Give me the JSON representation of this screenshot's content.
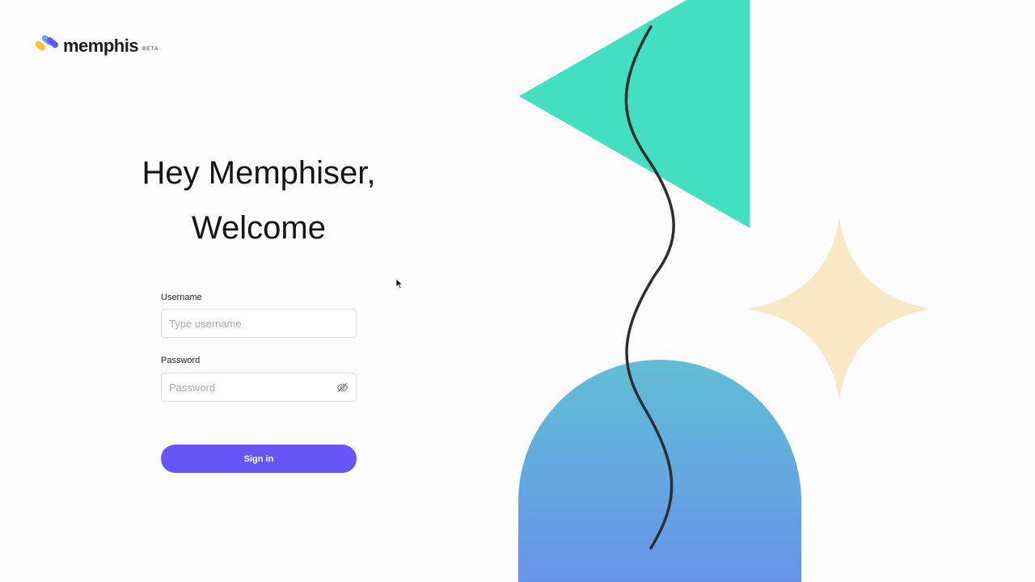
{
  "brand": {
    "name": "memphis",
    "badge": "BETA",
    "logo_icon": "memphis-logo-icon",
    "colors": {
      "yellow": "#f7c52b",
      "purple": "#6557f5",
      "blue": "#5aa9f5"
    }
  },
  "heading": {
    "line1": "Hey Memphiser,",
    "line2": "Welcome"
  },
  "form": {
    "username": {
      "label": "Username",
      "placeholder": "Type username",
      "value": ""
    },
    "password": {
      "label": "Password",
      "placeholder": "Password",
      "value": "",
      "toggle_icon": "eye-off-icon"
    },
    "submit_label": "Sign in"
  },
  "colors": {
    "accent": "#6557f5",
    "triangle": "#42e0c0",
    "star": "#f8e8c5",
    "arch_top": "#61bed5",
    "arch_bottom": "#6593e9",
    "squiggle": "#2e2e2e"
  }
}
